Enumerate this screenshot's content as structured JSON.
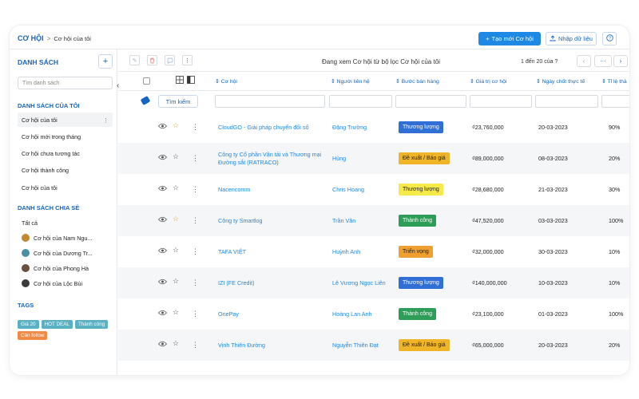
{
  "breadcrumb": {
    "module": "CƠ HỘI",
    "separator": ">",
    "current": "Cơ hội của tôi"
  },
  "topbar": {
    "create_label": "Tạo mới Cơ hội",
    "import_label": "Nhập dữ liệu",
    "help_icon": "question-icon"
  },
  "sidebar": {
    "title": "DANH SÁCH",
    "add_symbol": "+",
    "search_placeholder": "Tìm danh sách",
    "collapse_symbol": "‹",
    "my_lists_title": "DANH SÁCH CỦA TÔI",
    "my_lists": [
      "Cơ hội của tôi",
      "Cơ hội mới trong tháng",
      "Cơ hội chưa tương tác",
      "Cơ hội thành công",
      "Cơ hội của tôi"
    ],
    "shared_title": "DANH SÁCH CHIA SẺ",
    "shared": [
      {
        "label": "Tất cả",
        "avatar": ""
      },
      {
        "label": "Cơ hội của Nam Ngu...",
        "avatar": "#c2882f"
      },
      {
        "label": "Cơ hội của Dương Tr...",
        "avatar": "#4a90a4"
      },
      {
        "label": "Cơ hội của Phong Hà",
        "avatar": "#6b4e3d"
      },
      {
        "label": "Cơ hội của Lộc Bùi",
        "avatar": "#3b3b3b"
      }
    ],
    "tags_title": "TAGS",
    "tags": [
      {
        "label": "Giá 20",
        "color": "#5ab1c4"
      },
      {
        "label": "HOT DEAL",
        "color": "#5ab1c4"
      },
      {
        "label": "Thành công",
        "color": "#5ab1c4"
      },
      {
        "label": "Cần follow",
        "color": "#f08a45"
      }
    ]
  },
  "toolbar": {
    "title": "Đang xem Cơ hội từ bộ lọc Cơ hội của tôi",
    "count": "1 đến 20 của ?",
    "prev": "‹",
    "more": "···",
    "next": "›"
  },
  "columns": {
    "name": "Cơ hội",
    "contact": "Người liên hệ",
    "stage": "Bước bán hàng",
    "value": "Giá trị cơ hội",
    "close_date": "Ngày chốt thực tế",
    "rate": "Tỉ lệ thà"
  },
  "filter": {
    "search_label": "Tìm kiếm"
  },
  "rows": [
    {
      "name": "CloudGO - Giải pháp chuyển đổi số",
      "contact": "Đặng Trường",
      "stage": "Thương lượng",
      "stage_bg": "#2f6fd6",
      "stage_fg": "#ffffff",
      "value": "₫23,760,000",
      "date": "20-03-2023",
      "rate": "90%",
      "star": "#f0a030"
    },
    {
      "name": "Công ty Cổ phần Vận tải và Thương mại Đường sắt (RATRACO)",
      "contact": "Hùng",
      "stage": "Đề xuất / Báo giá",
      "stage_bg": "#f0b429",
      "stage_fg": "#222222",
      "value": "₫89,000,000",
      "date": "08-03-2023",
      "rate": "20%",
      "star": "#555555"
    },
    {
      "name": "Nacencomm",
      "contact": "Chris Hoang",
      "stage": "Thương lượng",
      "stage_bg": "#f7e94a",
      "stage_fg": "#222222",
      "value": "₫28,680,000",
      "date": "21-03-2023",
      "rate": "30%",
      "star": "#555555"
    },
    {
      "name": "Công ty Smartlog",
      "contact": "Trần Văn",
      "stage": "Thành công",
      "stage_bg": "#2e9d58",
      "stage_fg": "#ffffff",
      "value": "₫47,520,000",
      "date": "03-03-2023",
      "rate": "100%",
      "star": "#f0a030"
    },
    {
      "name": "TAFA VIỆT",
      "contact": "Huỳnh Anh",
      "stage": "Triển vọng",
      "stage_bg": "#f0a030",
      "stage_fg": "#222222",
      "value": "₫32,000,000",
      "date": "30-03-2023",
      "rate": "10%",
      "star": "#555555"
    },
    {
      "name": "IZI (FE Credit)",
      "contact": "Lê Vương Ngọc Liên",
      "stage": "Thương lượng",
      "stage_bg": "#2f6fd6",
      "stage_fg": "#ffffff",
      "value": "₫140,000,000",
      "date": "10-03-2023",
      "rate": "10%",
      "star": "#555555"
    },
    {
      "name": "OnePay",
      "contact": "Hoàng Lan Anh",
      "stage": "Thành công",
      "stage_bg": "#2e9d58",
      "stage_fg": "#ffffff",
      "value": "₫23,100,000",
      "date": "01-03-2023",
      "rate": "100%",
      "star": "#555555"
    },
    {
      "name": "Vịnh Thiên Đường",
      "contact": "Nguyễn Thiên Đạt",
      "stage": "Đề xuất / Báo giá",
      "stage_bg": "#f0b429",
      "stage_fg": "#222222",
      "value": "₫65,000,000",
      "date": "20-03-2023",
      "rate": "20%",
      "star": "#555555"
    }
  ]
}
